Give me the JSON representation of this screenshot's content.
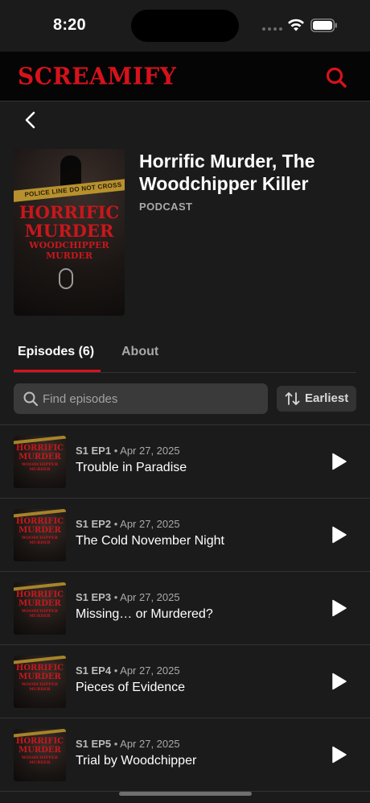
{
  "status": {
    "time": "8:20"
  },
  "app": {
    "brand": "SCREAMIFY"
  },
  "podcast": {
    "title": "Horrific Murder, The Woodchipper Killer",
    "type": "PODCAST",
    "cover_text": {
      "tape": "POLICE LINE DO NOT CROSS",
      "line1": "HORRIFIC",
      "line2": "MURDER",
      "line3": "WOODCHIPPER MURDER"
    }
  },
  "tabs": [
    {
      "label": "Episodes (6)",
      "active": true
    },
    {
      "label": "About",
      "active": false
    }
  ],
  "search": {
    "placeholder": "Find episodes",
    "value": ""
  },
  "sort": {
    "label": "Earliest"
  },
  "episodes": [
    {
      "code": "S1 EP1",
      "date": "Apr 27, 2025",
      "title": "Trouble in Paradise"
    },
    {
      "code": "S1 EP2",
      "date": "Apr 27, 2025",
      "title": "The Cold November Night"
    },
    {
      "code": "S1 EP3",
      "date": "Apr 27, 2025",
      "title": "Missing… or Murdered?"
    },
    {
      "code": "S1 EP4",
      "date": "Apr 27, 2025",
      "title": "Pieces of Evidence"
    },
    {
      "code": "S1 EP5",
      "date": "Apr 27, 2025",
      "title": "Trial by Woodchipper"
    }
  ],
  "icons": {
    "search": "search-icon",
    "back": "chevron-left-icon",
    "sort": "sort-arrows-icon",
    "play": "play-icon"
  },
  "colors": {
    "accent": "#d6121b",
    "background": "#1b1b1b",
    "header": "#050505"
  }
}
